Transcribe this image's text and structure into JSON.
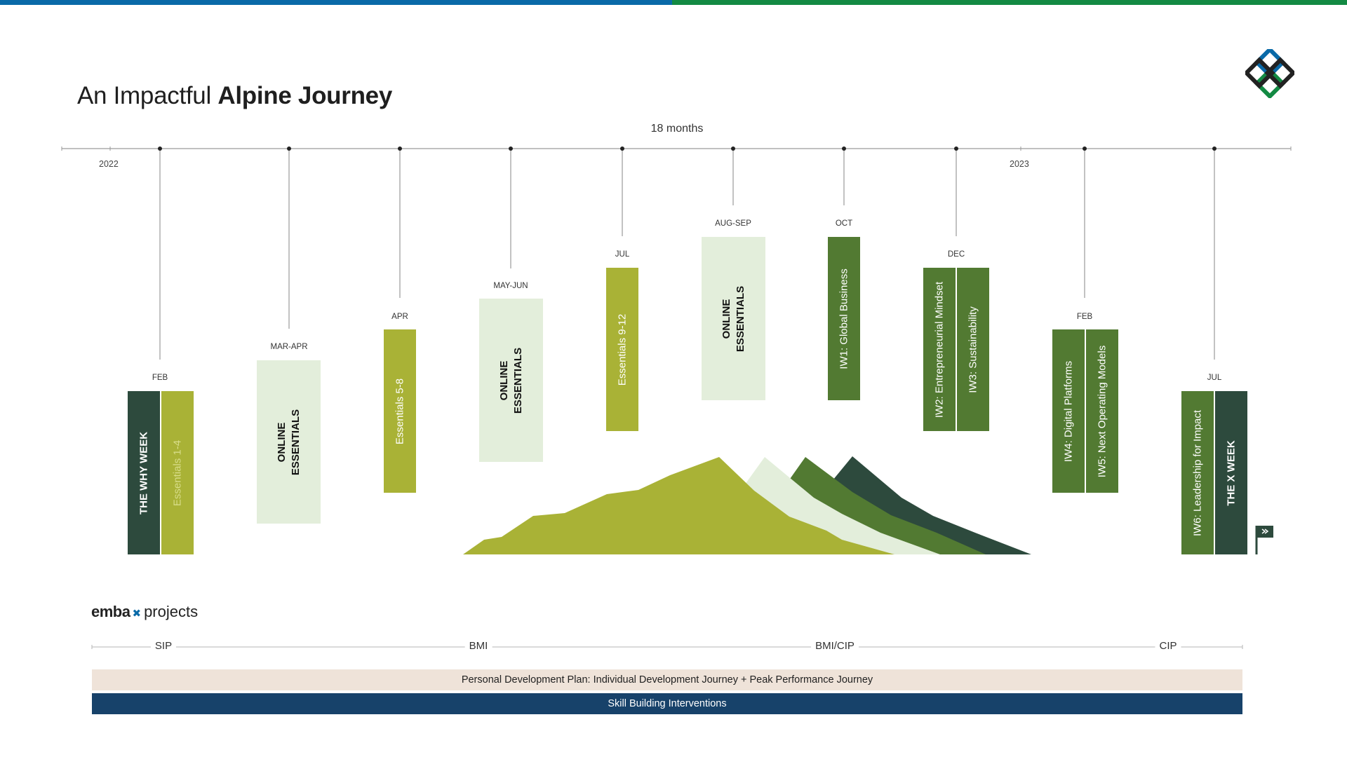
{
  "title": {
    "light": "An Impactful ",
    "bold": "Alpine Journey"
  },
  "duration": "18 months",
  "years": [
    "2022",
    "2023"
  ],
  "colors": {
    "dark_green": "#2d4a3d",
    "olive": "#a9b236",
    "mid_green": "#527a32",
    "pale_green": "#e3eedb",
    "navy": "#17426a",
    "beige": "#efe3d9"
  },
  "milestones": [
    {
      "month": "FEB",
      "blocks": [
        {
          "text": "THE WHY WEEK",
          "style": "dark"
        },
        {
          "text": "Essentials 1-4",
          "style": "olive-faded"
        }
      ]
    },
    {
      "month": "MAR-APR",
      "blocks": [
        {
          "text": "ONLINE ESSENTIALS",
          "style": "pale"
        }
      ]
    },
    {
      "month": "APR",
      "blocks": [
        {
          "text": "Essentials 5-8",
          "style": "olive"
        }
      ]
    },
    {
      "month": "MAY-JUN",
      "blocks": [
        {
          "text": "ONLINE ESSENTIALS",
          "style": "pale"
        }
      ]
    },
    {
      "month": "JUL",
      "blocks": [
        {
          "text": "Essentials 9-12",
          "style": "olive"
        }
      ]
    },
    {
      "month": "AUG-SEP",
      "blocks": [
        {
          "text": "ONLINE ESSENTIALS",
          "style": "pale"
        }
      ]
    },
    {
      "month": "OCT",
      "blocks": [
        {
          "text": "IW1: Global Business",
          "style": "mid"
        }
      ]
    },
    {
      "month": "DEC",
      "blocks": [
        {
          "text": "IW2: Entrepreneurial Mindset",
          "style": "mid"
        },
        {
          "text": "IW3: Sustainability",
          "style": "mid"
        }
      ]
    },
    {
      "month": "FEB",
      "blocks": [
        {
          "text": "IW4: Digital Platforms",
          "style": "mid"
        },
        {
          "text": "IW5: Next Operating Models",
          "style": "mid"
        }
      ]
    },
    {
      "month": "JUL",
      "blocks": [
        {
          "text": "IW6: Leadership for Impact",
          "style": "mid"
        },
        {
          "text": "THE X WEEK",
          "style": "dark"
        }
      ]
    }
  ],
  "footer": {
    "logo_bold": "emba",
    "logo_light": "projects",
    "phases": [
      "SIP",
      "BMI",
      "BMI/CIP",
      "CIP"
    ],
    "band_personal": "Personal Development Plan: Individual Development Journey + Peak Performance Journey",
    "band_skill": "Skill Building Interventions"
  }
}
